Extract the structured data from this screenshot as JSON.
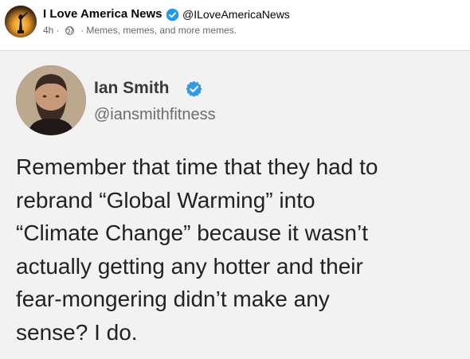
{
  "header": {
    "page_name": "I Love America News",
    "page_handle": "@ILoveAmericaNews",
    "time_ago": "4h",
    "separator": "·",
    "description": "Memes, memes, and more memes."
  },
  "tweet": {
    "author_name": "Ian Smith",
    "author_handle": "@iansmithfitness",
    "text": "Remember that time that they had to\nrebrand “Global Warming” into\n“Climate Change” because it wasn’t\nactually getting any hotter and their\nfear-mongering didn’t make any\nsense? I do."
  },
  "colors": {
    "verified_blue": "#1d9bf0",
    "meta_gray": "#65676b",
    "card_background": "#f2f2f2"
  },
  "icons": {
    "page_verified": "verified-badge-icon",
    "audience": "globe-icon",
    "tweet_verified": "verified-badge-icon"
  }
}
